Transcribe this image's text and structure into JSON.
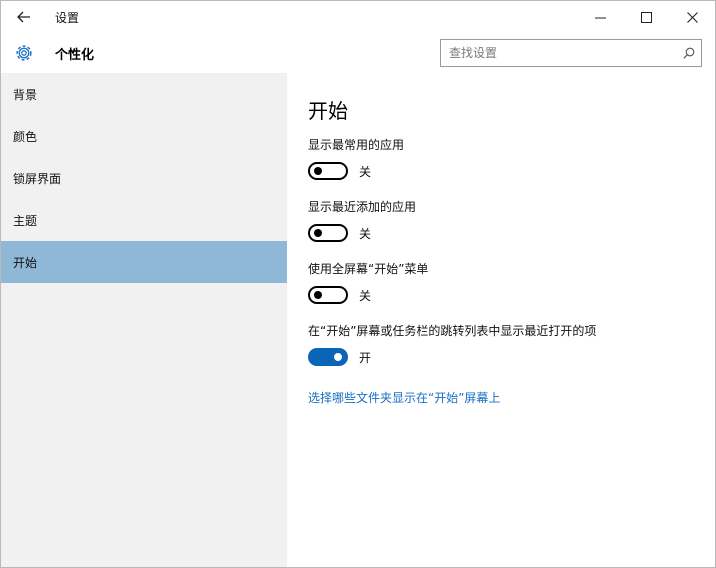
{
  "window": {
    "title": "设置",
    "back_icon": "back-arrow-icon",
    "controls": [
      "minimize-icon",
      "maximize-icon",
      "close-icon"
    ]
  },
  "header": {
    "icon": "gear-icon",
    "title": "个性化",
    "search_placeholder": "查找设置"
  },
  "sidebar": {
    "items": [
      {
        "label": "背景",
        "selected": false
      },
      {
        "label": "颜色",
        "selected": false
      },
      {
        "label": "锁屏界面",
        "selected": false
      },
      {
        "label": "主题",
        "selected": false
      },
      {
        "label": "开始",
        "selected": true
      }
    ],
    "selected_color": "#8fb8d7"
  },
  "main": {
    "title": "开始",
    "settings": [
      {
        "label": "显示最常用的应用",
        "state": "关",
        "on": false
      },
      {
        "label": "显示最近添加的应用",
        "state": "关",
        "on": false
      },
      {
        "label": "使用全屏幕“开始”菜单",
        "state": "关",
        "on": false
      },
      {
        "label": "在“开始”屏幕或任务栏的跳转列表中显示最近打开的项",
        "state": "开",
        "on": true
      }
    ],
    "link": "选择哪些文件夹显示在“开始”屏幕上"
  },
  "colors": {
    "accent": "#0a64b8",
    "link": "#1a6fc4"
  }
}
